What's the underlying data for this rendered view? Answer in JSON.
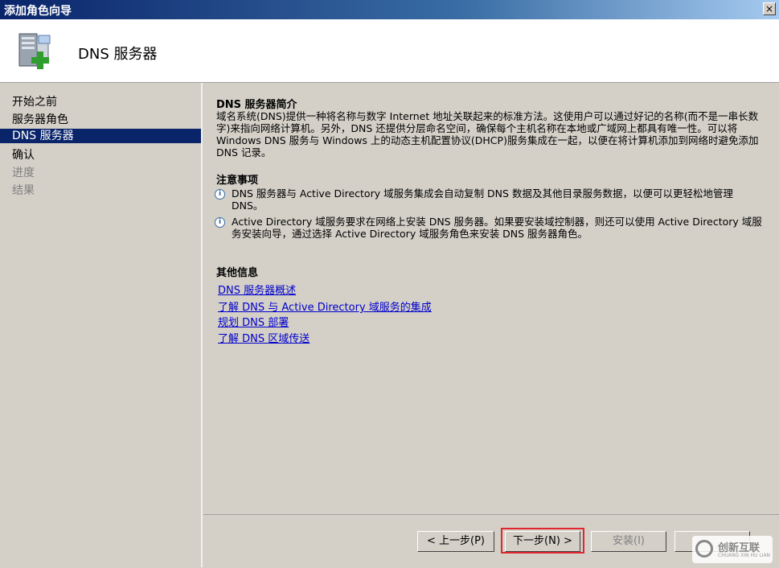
{
  "window": {
    "title": "添加角色向导",
    "close_label": "×"
  },
  "header": {
    "title": "DNS  服务器",
    "icon": "server-add-icon"
  },
  "sidebar": {
    "items": [
      {
        "label": "开始之前",
        "state": "normal"
      },
      {
        "label": "服务器角色",
        "state": "normal"
      },
      {
        "label": "DNS 服务器",
        "state": "active"
      },
      {
        "label": "确认",
        "state": "normal"
      },
      {
        "label": "进度",
        "state": "disabled"
      },
      {
        "label": "结果",
        "state": "disabled"
      }
    ]
  },
  "main": {
    "intro_title": "DNS 服务器简介",
    "intro_text": "域名系统(DNS)提供一种将名称与数字 Internet 地址关联起来的标准方法。这使用户可以通过好记的名称(而不是一串长数字)来指向网络计算机。另外，DNS 还提供分层命名空间，确保每个主机名称在本地或广域网上都具有唯一性。可以将 Windows DNS 服务与 Windows 上的动态主机配置协议(DHCP)服务集成在一起，以便在将计算机添加到网络时避免添加 DNS 记录。",
    "notes_title": "注意事项",
    "notes": [
      "DNS 服务器与 Active Directory 域服务集成会自动复制 DNS 数据及其他目录服务数据，以便可以更轻松地管理 DNS。",
      "Active Directory 域服务要求在网络上安装 DNS 服务器。如果要安装域控制器，则还可以使用 Active Directory 域服务安装向导，通过选择 Active Directory 域服务角色来安装 DNS 服务器角色。"
    ],
    "more_title": "其他信息",
    "links": [
      "DNS 服务器概述",
      "了解 DNS 与 Active Directory 域服务的集成",
      "规划 DNS 部署",
      "了解 DNS 区域传送"
    ]
  },
  "buttons": {
    "back": "< 上一步(P)",
    "next": "下一步(N) >",
    "install": "安装(I)",
    "cancel": ""
  },
  "watermark": {
    "text": "创新互联",
    "sub": "CHUANG XIN HU LIAN"
  }
}
